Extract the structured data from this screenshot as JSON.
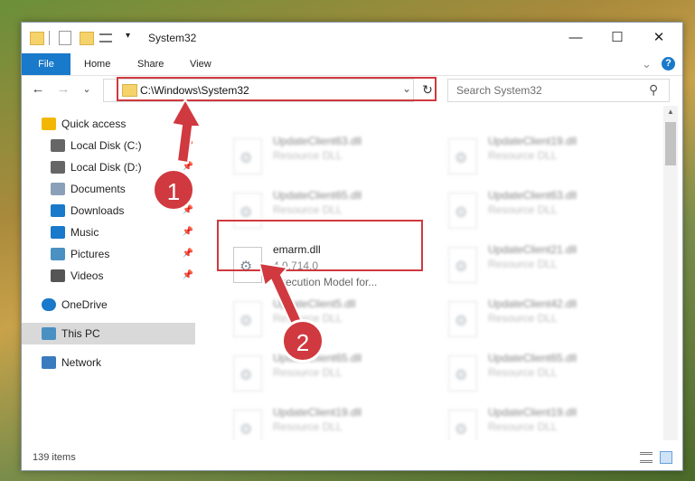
{
  "window": {
    "title": "System32",
    "controls": {
      "minimize": "—",
      "maximize": "☐",
      "close": "✕"
    }
  },
  "ribbon": {
    "file": "File",
    "tabs": [
      "Home",
      "Share",
      "View"
    ],
    "expand": "⌄",
    "help": "?"
  },
  "nav": {
    "back": "←",
    "forward": "→",
    "recent": "⌄",
    "up": "↑",
    "address": "C:\\Windows\\System32",
    "address_dropdown": "⌄",
    "refresh": "↻",
    "search_placeholder": "Search System32",
    "search_icon": "⚲"
  },
  "sidebar": {
    "items": [
      {
        "label": "Quick access",
        "icon": "star-icon",
        "pinned": false
      },
      {
        "label": "Local Disk (C:)",
        "icon": "drive-icon",
        "pinned": true
      },
      {
        "label": "Local Disk (D:)",
        "icon": "drive-icon",
        "pinned": true
      },
      {
        "label": "Documents",
        "icon": "documents-icon",
        "pinned": true
      },
      {
        "label": "Downloads",
        "icon": "download-icon",
        "pinned": true
      },
      {
        "label": "Music",
        "icon": "music-icon",
        "pinned": true
      },
      {
        "label": "Pictures",
        "icon": "pictures-icon",
        "pinned": true
      },
      {
        "label": "Videos",
        "icon": "videos-icon",
        "pinned": true
      },
      {
        "label": "OneDrive",
        "icon": "cloud-icon",
        "pinned": false
      },
      {
        "label": "This PC",
        "icon": "computer-icon",
        "pinned": false,
        "selected": true
      },
      {
        "label": "Network",
        "icon": "network-icon",
        "pinned": false
      }
    ],
    "pin_glyph": "📌"
  },
  "files": {
    "left": [
      {
        "name": "UpdateClient63.dll",
        "type": "Resource DLL"
      },
      {
        "name": "UpdateClient65.dll",
        "type": "Resource DLL"
      },
      {
        "name": "emarm.dll",
        "version": "4.0.714.0",
        "description": "Execution Model for...",
        "highlighted": true
      },
      {
        "name": "UpdateClient5.dll",
        "type": "Resource DLL"
      },
      {
        "name": "UpdateClient65.dll",
        "type": "Resource DLL"
      },
      {
        "name": "UpdateClient19.dll",
        "type": "Resource DLL"
      }
    ],
    "right": [
      {
        "name": "UpdateClient19.dll",
        "type": "Resource DLL"
      },
      {
        "name": "UpdateClient63.dll",
        "type": "Resource DLL"
      },
      {
        "name": "UpdateClient21.dll",
        "type": "Resource DLL"
      },
      {
        "name": "UpdateClient42.dll",
        "type": "Resource DLL"
      },
      {
        "name": "UpdateClient65.dll",
        "type": "Resource DLL"
      },
      {
        "name": "UpdateClient19.dll",
        "type": "Resource DLL"
      }
    ]
  },
  "status": {
    "count": "139 items"
  },
  "annotations": {
    "step1": "1",
    "step2": "2",
    "color": "#d0393f"
  }
}
